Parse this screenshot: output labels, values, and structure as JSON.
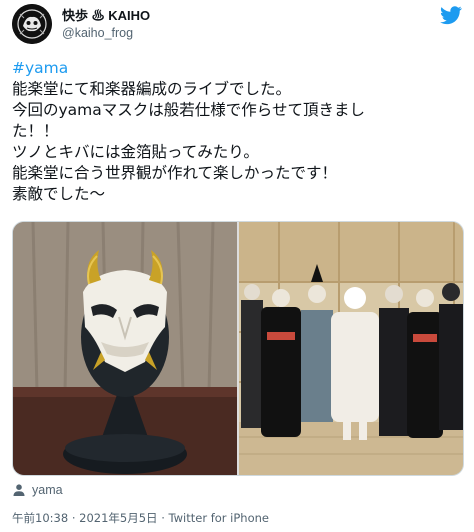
{
  "tweet": {
    "display_name": "快歩 ♨ KAIHO",
    "handle": "@kaiho_frog",
    "hashtag": "#yama",
    "lines": [
      "能楽堂にて和楽器編成のライブでした。",
      "今回のyamaマスクは般若仕様で作らせて頂きまし",
      "た！！",
      "ツノとキバには金箔貼ってみたり。",
      "能楽堂に合う世界観が作れて楽しかったです！",
      "素敵でした〜"
    ],
    "tagged_user": "yama",
    "time": "午前10:38",
    "date": "2021年5月5日",
    "source": "Twitter for iPhone",
    "separator": "·"
  },
  "icons": {
    "brand": "twitter-bird-icon",
    "tagged": "person-icon"
  },
  "colors": {
    "link": "#1d9bf0",
    "secondary_text": "#536471",
    "primary_text": "#0f1419"
  }
}
